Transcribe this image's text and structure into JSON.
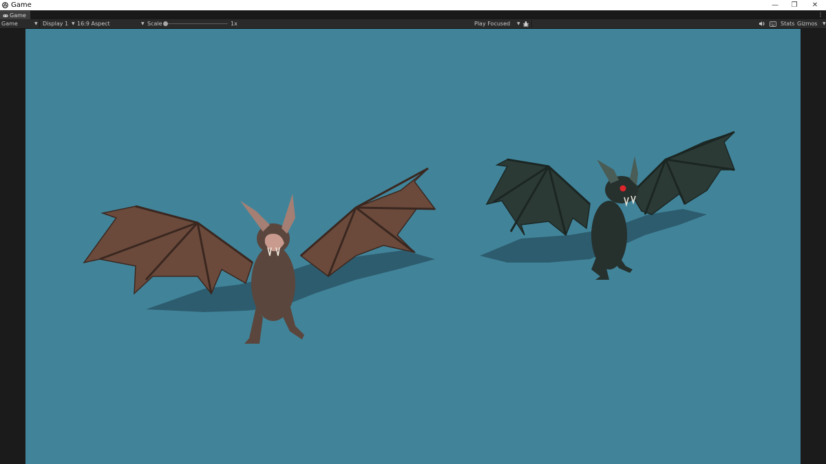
{
  "window": {
    "title": "Game",
    "controls": [
      "—",
      "❐",
      "✕"
    ]
  },
  "tabs": [
    {
      "label": "Game",
      "icon": "gamepad-icon"
    }
  ],
  "toolbar": {
    "view_mode": "Game",
    "display": "Display 1",
    "aspect": "16:9 Aspect",
    "scale_label": "Scale",
    "scale_value": "1x",
    "scale_fraction": 0.0,
    "play_mode": "Play Focused",
    "bug_icon": "bug-icon",
    "audio_icon": "speaker-icon",
    "stats_icon": "keyboard-icon",
    "stats_label": "Stats",
    "gizmos_label": "Gizmos",
    "kebab": "⋮"
  },
  "scene": {
    "background_color": "#41849a",
    "creatures": [
      {
        "name": "brown-bat",
        "color": "#6b4a3c"
      },
      {
        "name": "dark-green-bat",
        "color": "#2c3a36",
        "eye_color": "#e0262a"
      }
    ]
  }
}
